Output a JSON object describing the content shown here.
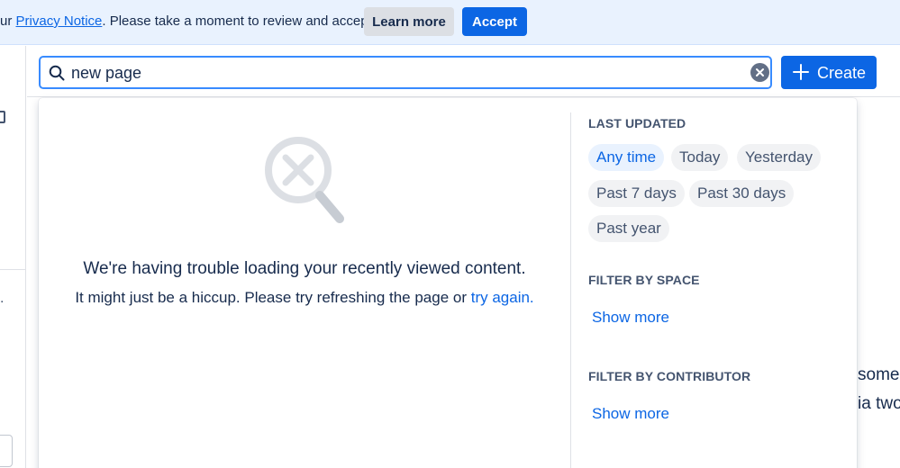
{
  "banner": {
    "prefix": "ur ",
    "privacy_link": "Privacy Notice",
    "suffix": ". Please take a moment to review and accept.",
    "learn_more": "Learn more",
    "accept": "Accept"
  },
  "search": {
    "value": "new page",
    "placeholder": ""
  },
  "header": {
    "create_label": "Create"
  },
  "error": {
    "title": "We're having trouble loading your recently viewed content.",
    "message_prefix": "It might just be a hiccup. Please try refreshing the page or ",
    "retry_link": "try again."
  },
  "filters": {
    "last_updated": {
      "heading": "LAST UPDATED",
      "chips": [
        "Any time",
        "Today",
        "Yesterday",
        "Past 7 days",
        "Past 30 days",
        "Past year"
      ],
      "selected": "Any time"
    },
    "space": {
      "heading": "FILTER BY SPACE",
      "show_more": "Show more"
    },
    "contributor": {
      "heading": "FILTER BY CONTRIBUTOR",
      "show_more": "Show more"
    }
  },
  "background": {
    "rail_dot": ".",
    "text_line_1": "some l",
    "text_line_2": "ia two"
  },
  "icons": {
    "search": "search-icon",
    "clear": "clear-icon",
    "create": "plus-icon",
    "error": "search-error-icon"
  },
  "colors": {
    "accent": "#0c66e4",
    "banner_bg": "#e9f2fe",
    "chip_bg": "#f1f2f4",
    "chip_selected_bg": "#e9f2fe",
    "focus_border": "#388bff"
  }
}
